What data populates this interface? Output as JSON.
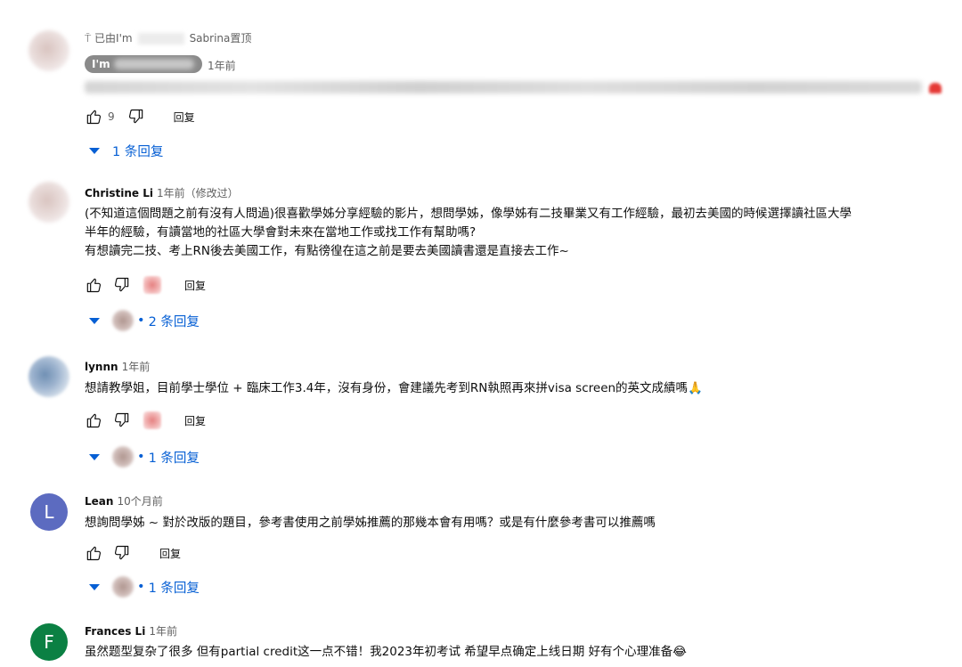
{
  "pinned": {
    "pin_prefix": "已由I'm",
    "pin_suffix": "Sabrina置顶",
    "author_chip": "I'm",
    "time": "1年前",
    "likes": "9",
    "reply_label": "回复",
    "replies_label": "1 条回复"
  },
  "comments": [
    {
      "author": "Christine Li",
      "time": "1年前（修改过）",
      "lines": [
        "(不知道這個問題之前有沒有人問過)很喜歡學姊分享經驗的影片，想問學姊，像學姊有二技畢業又有工作經驗，最初去美國的時候選擇讀社區大學",
        "半年的經驗，有讀當地的社區大學會對未來在當地工作或找工作有幫助嗎?",
        "有想讀完二技、考上RN後去美國工作，有點徬徨在這之前是要去美國讀書還是直接去工作~"
      ],
      "reply_label": "回复",
      "replies_label": "2 条回复"
    },
    {
      "author": "lynnn",
      "time": "1年前",
      "lines": [
        "想請教學姐，目前學士學位 + 臨床工作3.4年，沒有身份，會建議先考到RN執照再來拼visa screen的英文成績嗎🙏"
      ],
      "reply_label": "回复",
      "replies_label": "1 条回复"
    },
    {
      "author": "Lean",
      "avatar_letter": "L",
      "avatar_color": "#5c6bc0",
      "time": "10个月前",
      "lines": [
        "想詢問學姊 ~ 對於改版的題目，參考書使用之前學姊推薦的那幾本會有用嗎？或是有什麼參考書可以推薦嗎"
      ],
      "reply_label": "回复",
      "replies_label": "1 条回复"
    },
    {
      "author": "Frances Li",
      "avatar_letter": "F",
      "avatar_color": "#0b8043",
      "time": "1年前",
      "lines": [
        "虽然题型复杂了很多 但有partial credit这一点不错！我2023年初考试 希望早点确定上线日期 好有个心理准备😂"
      ]
    }
  ],
  "icons": {
    "like": "thumbs-up-icon",
    "dislike": "thumbs-down-icon",
    "expand": "caret-down-icon",
    "pin": "pin-icon"
  },
  "colors": {
    "link_blue": "#065fd4",
    "secondary_text": "#606060"
  }
}
